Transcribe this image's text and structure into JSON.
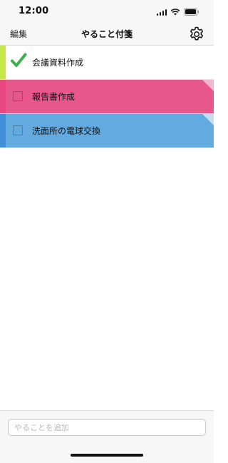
{
  "status_bar": {
    "time": "12:00",
    "icons": [
      "signal-icon",
      "wifi-icon",
      "battery-icon"
    ]
  },
  "nav": {
    "edit_label": "編集",
    "title": "やること付箋",
    "settings_icon": "gear-icon"
  },
  "tasks": [
    {
      "label": "会議資料作成",
      "completed": true,
      "color": "#c6e84a",
      "row_bg": "#ffffff",
      "fold_color": null
    },
    {
      "label": "報告書作成",
      "completed": false,
      "color": "#e8477f",
      "row_bg": "#e8578a",
      "fold_color": "#f4b8cc"
    },
    {
      "label": "洗面所の電球交換",
      "completed": false,
      "color": "#3f8fd9",
      "row_bg": "#62aadf",
      "fold_color": "#c2def2"
    }
  ],
  "add_task": {
    "placeholder": "やることを追加",
    "value": ""
  },
  "colors": {
    "checkmark": "#3bb24a",
    "bar_background": "#f7f7f7"
  }
}
